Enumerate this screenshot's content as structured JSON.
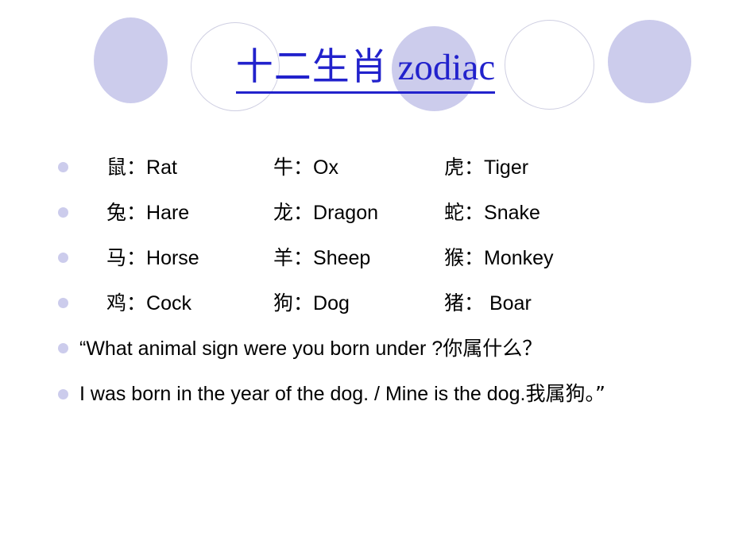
{
  "slide": {
    "background_color": "#ffffff",
    "title": {
      "chinese": "十二生肖",
      "english": " zodiac",
      "color": "#2222cc",
      "underlined": true
    },
    "decor": {
      "accent_color": "#ccccec",
      "outline_color": "#cfcfe2",
      "circles": [
        {
          "name": "circle-1",
          "style": "filled"
        },
        {
          "name": "circle-2",
          "style": "outlined"
        },
        {
          "name": "circle-3",
          "style": "filled"
        },
        {
          "name": "circle-4",
          "style": "outlined"
        },
        {
          "name": "circle-5",
          "style": "filled"
        }
      ]
    },
    "bullet_color": "#ccccec",
    "zodiac_rows": [
      {
        "a": {
          "cn": "鼠：",
          "en": "Rat"
        },
        "b": {
          "cn": "牛：",
          "en": "Ox"
        },
        "c": {
          "cn": "虎：",
          "en": "Tiger"
        }
      },
      {
        "a": {
          "cn": "兔：",
          "en": "Hare"
        },
        "b": {
          "cn": "龙：",
          "en": "Dragon"
        },
        "c": {
          "cn": "蛇：",
          "en": "Snake"
        }
      },
      {
        "a": {
          "cn": "马：",
          "en": "Horse"
        },
        "b": {
          "cn": "羊：",
          "en": "Sheep"
        },
        "c": {
          "cn": "猴：",
          "en": "Monkey"
        }
      },
      {
        "a": {
          "cn": "鸡：",
          "en": "Cock"
        },
        "b": {
          "cn": "狗：",
          "en": "Dog"
        },
        "c": {
          "cn": "猪：",
          "en": " Boar"
        }
      }
    ],
    "sentences": [
      {
        "en": "“What animal sign were you born under ?",
        "cn": "你属什么？"
      },
      {
        "en": "I was born in the year of the dog.  / Mine is the dog.",
        "cn": "我属狗。”"
      }
    ]
  }
}
